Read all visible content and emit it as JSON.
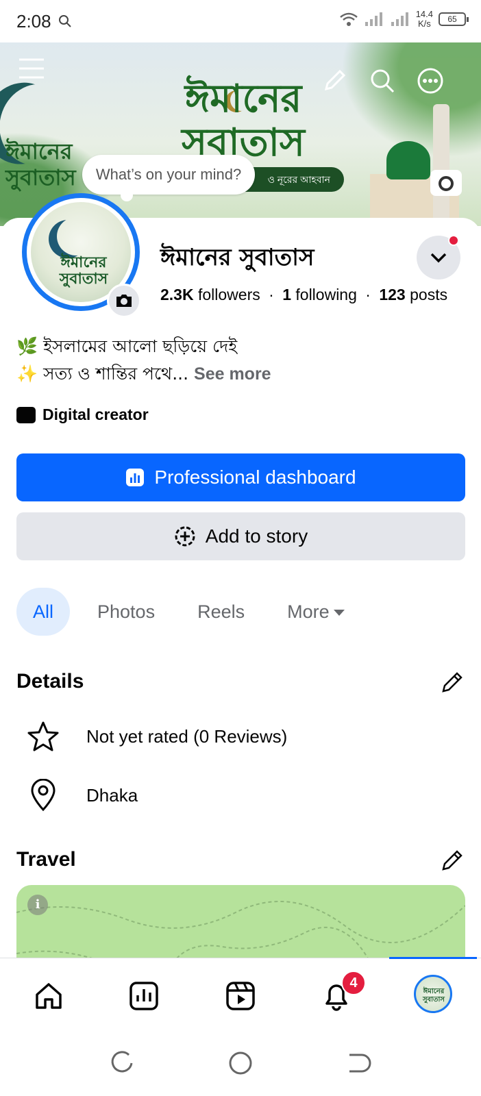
{
  "status_bar": {
    "time": "2:08",
    "net_speed_value": "14.4",
    "net_speed_unit": "K/s",
    "battery": "65"
  },
  "cover": {
    "title_line1": "ঈমানের",
    "title_line2": "সুবাতাস",
    "subtitle": "ও নূরের আহবান",
    "logo_line1": "ঈমানের",
    "logo_line2": "সুবাতাস"
  },
  "composer": {
    "placeholder": "What’s on your mind?"
  },
  "profile": {
    "name": "ঈমানের সুবাতাস",
    "followers_count": "2.3K",
    "followers_label": "followers",
    "following_count": "1",
    "following_label": "following",
    "posts_count": "123",
    "posts_label": "posts",
    "separator": "·",
    "avatar_text": "ঈমানের সুবাতাস",
    "bio_line1": "🌿 ইসলামের আলো ছড়িয়ে দেই",
    "bio_line2": "✨ সত্য ও শান্তির পথে...",
    "see_more": "See more",
    "category": "Digital creator"
  },
  "actions": {
    "professional_dashboard": "Professional dashboard",
    "add_to_story": "Add to story"
  },
  "tabs": [
    {
      "label": "All",
      "active": true
    },
    {
      "label": "Photos",
      "active": false
    },
    {
      "label": "Reels",
      "active": false
    },
    {
      "label": "More",
      "active": false
    }
  ],
  "details": {
    "title": "Details",
    "rating": "Not yet rated (0 Reviews)",
    "location": "Dhaka"
  },
  "travel": {
    "title": "Travel"
  },
  "bottom_nav": {
    "notifications_badge": "4",
    "avatar_text": "ঈমানের সুবাতাস"
  },
  "colors": {
    "accent": "#0866ff",
    "badge": "#e41e3f",
    "secondary_bg": "#e4e6eb"
  },
  "icons": [
    "menu-icon",
    "edit-icon",
    "search-icon",
    "more-icon",
    "camera-icon",
    "chevron-down-icon",
    "dashboard-icon",
    "add-story-icon",
    "star-icon",
    "location-icon",
    "home-icon",
    "insights-icon",
    "reels-icon",
    "bell-icon"
  ]
}
